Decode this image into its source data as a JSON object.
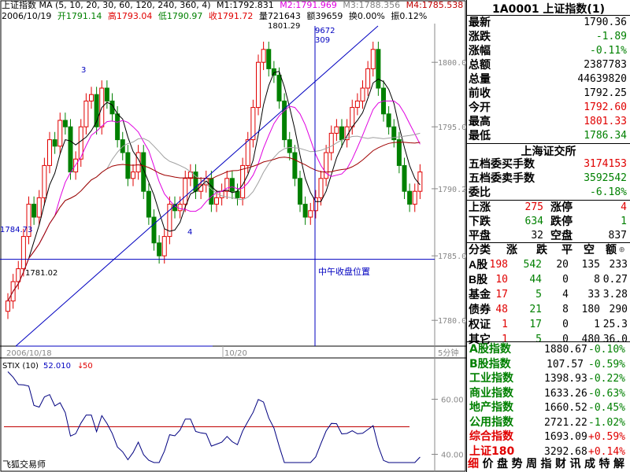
{
  "header": {
    "ma_title": "上证指数 MA (5, 10, 20, 30, 60, 120, 240, 360, 4)",
    "ma_values": [
      {
        "label": "M1:1792.831",
        "color": "#000000"
      },
      {
        "label": "M2:1791.969",
        "color": "#e000e0"
      },
      {
        "label": "M3:1788.356",
        "color": "#808080"
      },
      {
        "label": "M4:1785.538",
        "color": "#c00000"
      }
    ],
    "date": "2006/10/19",
    "open": "开1791.14",
    "high": "高1793.04",
    "low": "低1790.97",
    "close": "收1791.72",
    "volume": "量721643",
    "amount": "额39659",
    "turnover": "换0.00%",
    "amplitude": "振0.12%"
  },
  "chart": {
    "y_ticks": [
      "1800.0",
      "1795.0",
      "1790.2",
      "1785.0",
      "1780.0"
    ],
    "x_labels": [
      "2006/10/18",
      "10/20"
    ],
    "period_label": "5分钟",
    "annotations": {
      "high_label": "1801.29",
      "low_label": "1781.02",
      "level_label": "1784.73",
      "count_top": "9672",
      "count_bottom": "309",
      "wave3": "3",
      "wave4": "4",
      "noon_label": "中午收盘位置"
    },
    "stix_title": "STIX (10)",
    "stix_value": "52.010",
    "stix_ref": "50",
    "stix_ticks": [
      "60.00",
      "40.00"
    ],
    "software": "飞狐交易师"
  },
  "chart_data": {
    "type": "candlestick",
    "ylim": [
      1778,
      1803
    ],
    "y_ticks": [
      1800.0,
      1795.0,
      1790.2,
      1785.0,
      1780.0
    ],
    "high_marker": 1801.29,
    "low_marker": 1781.02,
    "support_level": 1784.73,
    "closes": [
      1781.5,
      1783,
      1784,
      1786.5,
      1789,
      1788,
      1789.5,
      1792,
      1794,
      1793.5,
      1795.5,
      1795,
      1791.5,
      1792.5,
      1795,
      1797,
      1797.5,
      1795,
      1798,
      1797,
      1796,
      1794,
      1793,
      1791,
      1791.5,
      1793,
      1790,
      1788,
      1786,
      1785,
      1786.5,
      1789,
      1788.5,
      1789,
      1791,
      1791.5,
      1790,
      1790.5,
      1791,
      1789,
      1789.5,
      1790,
      1791,
      1790,
      1789.5,
      1792,
      1794,
      1796.5,
      1800,
      1801,
      1799.5,
      1799,
      1797,
      1794,
      1793,
      1791,
      1789,
      1788,
      1788.5,
      1789.5,
      1791,
      1793,
      1794.5,
      1795,
      1794,
      1795,
      1796.5,
      1797,
      1798,
      1799.5,
      1801,
      1798,
      1796,
      1795,
      1794,
      1792,
      1790,
      1789,
      1790,
      1791.5
    ],
    "stix": {
      "ref": 50,
      "ylim": [
        35,
        75
      ],
      "ticks": [
        60,
        40
      ],
      "last": 52.01
    }
  },
  "panel": {
    "title": "1A0001 上证指数(1)",
    "quote": [
      {
        "label": "最新",
        "value": "1790.36",
        "color": "#000000"
      },
      {
        "label": "涨跌",
        "value": "-1.89",
        "color": "#008000"
      },
      {
        "label": "涨幅",
        "value": "-0.11%",
        "color": "#008000"
      },
      {
        "label": "总额",
        "value": "2387783",
        "color": "#000000"
      },
      {
        "label": "总量",
        "value": "44639820",
        "color": "#000000"
      },
      {
        "label": "前收",
        "value": "1792.25",
        "color": "#000000"
      },
      {
        "label": "今开",
        "value": "1792.60",
        "color": "#e00000"
      },
      {
        "label": "最高",
        "value": "1801.33",
        "color": "#e00000"
      },
      {
        "label": "最低",
        "value": "1786.34",
        "color": "#008000"
      }
    ],
    "exchange": "上海证交所",
    "orders": [
      {
        "label": "五档委买手数",
        "value": "3174153",
        "color": "#e00000"
      },
      {
        "label": "五档委卖手数",
        "value": "3592542",
        "color": "#008000"
      },
      {
        "label": "委比",
        "value": "-6.18%",
        "color": "#008000"
      }
    ],
    "breadth": [
      {
        "l1": "上涨",
        "v1": "275",
        "c1": "#e00000",
        "l2": "涨停",
        "v2": "4",
        "c2": "#e00000"
      },
      {
        "l1": "下跌",
        "v1": "634",
        "c1": "#008000",
        "l2": "跌停",
        "v2": "1",
        "c2": "#008000"
      },
      {
        "l1": "平盘",
        "v1": "32",
        "c1": "#000000",
        "l2": "空盘",
        "v2": "837",
        "c2": "#000000"
      }
    ],
    "table_headers": [
      "分类",
      "涨",
      "跌",
      "平",
      "空",
      "额"
    ],
    "table_rows": [
      {
        "name": "A股",
        "up": "198",
        "down": "542",
        "flat": "20",
        "empty": "135",
        "amt": "233"
      },
      {
        "name": "B股",
        "up": "10",
        "down": "44",
        "flat": "0",
        "empty": "8",
        "amt": "0.27"
      },
      {
        "name": "基金",
        "up": "17",
        "down": "5",
        "flat": "4",
        "empty": "33",
        "amt": "3.28"
      },
      {
        "name": "债券",
        "up": "48",
        "down": "21",
        "flat": "8",
        "empty": "180",
        "amt": "290"
      },
      {
        "name": "权证",
        "up": "1",
        "down": "17",
        "flat": "0",
        "empty": "1",
        "amt": "25.3"
      },
      {
        "name": "其它",
        "up": "1",
        "down": "5",
        "flat": "0",
        "empty": "480",
        "amt": "36.0"
      }
    ],
    "indices": [
      {
        "name": "A股指数",
        "value": "1880.67",
        "pct": "-0.10%",
        "color": "#008000",
        "ncolor": "#008000"
      },
      {
        "name": "B股指数",
        "value": "107.57",
        "pct": "-0.59%",
        "color": "#008000",
        "ncolor": "#008000"
      },
      {
        "name": "工业指数",
        "value": "1398.93",
        "pct": "-0.22%",
        "color": "#008000",
        "ncolor": "#008000"
      },
      {
        "name": "商业指数",
        "value": "1633.26",
        "pct": "-0.63%",
        "color": "#008000",
        "ncolor": "#008000"
      },
      {
        "name": "地产指数",
        "value": "1660.52",
        "pct": "-0.45%",
        "color": "#008000",
        "ncolor": "#008000"
      },
      {
        "name": "公用指数",
        "value": "2721.22",
        "pct": "-1.02%",
        "color": "#008000",
        "ncolor": "#008000"
      },
      {
        "name": "综合指数",
        "value": "1693.09",
        "pct": "+0.59%",
        "color": "#e00000",
        "ncolor": "#e00000"
      },
      {
        "name": "上证180",
        "value": "3292.68",
        "pct": "+0.14%",
        "color": "#e00000",
        "ncolor": "#e00000"
      }
    ],
    "tabs": [
      "细",
      "价",
      "盘",
      "势",
      "周",
      "指",
      "财",
      "讯",
      "成",
      "特",
      "解"
    ]
  }
}
